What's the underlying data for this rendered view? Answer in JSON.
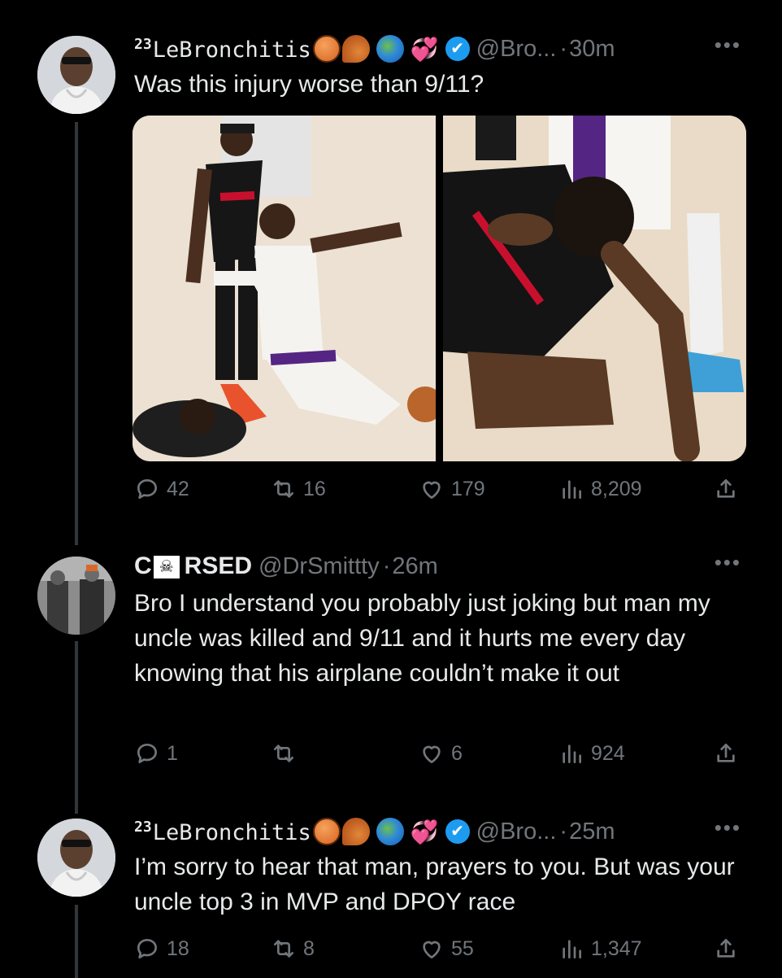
{
  "tweets": [
    {
      "name_sup": "23",
      "name": "LeBronchitis",
      "handle": "@Bro...",
      "dot": "·",
      "time": "30m",
      "more": "•••",
      "text": "Was this injury worse than 9/11?",
      "replies": "42",
      "retweets": "16",
      "likes": "179",
      "views": "8,209"
    },
    {
      "name": "C",
      "name_flag": "☠",
      "name_rest": "RSED",
      "handle": "@DrSmittty",
      "dot": "·",
      "time": "26m",
      "more": "•••",
      "text": "Bro I understand you probably just joking but man my uncle was killed and 9/11 and it hurts me every day knowing that his airplane couldn’t make it out",
      "replies": "1",
      "retweets": "",
      "likes": "6",
      "views": "924"
    },
    {
      "name_sup": "23",
      "name": "LeBronchitis",
      "handle": "@Bro...",
      "dot": "·",
      "time": "25m",
      "more": "•••",
      "text": "I’m sorry to hear that man, prayers to you. But was your uncle top 3 in MVP and DPOY race",
      "replies": "18",
      "retweets": "8",
      "likes": "55",
      "views": "1,347"
    }
  ],
  "icons": {
    "reply": "reply-icon",
    "retweet": "retweet-icon",
    "like": "heart-icon",
    "views": "views-icon",
    "share": "share-icon",
    "verified": "verified-badge-icon",
    "name_emojis": [
      "basketball-emoji",
      "comet-emoji",
      "globe-emoji",
      "hearts-emoji"
    ]
  },
  "verified_mark": "✔",
  "hearts_glyph": "💞",
  "colors": {
    "background": "#000000",
    "text": "#e7e9ea",
    "muted": "#71767b",
    "verified": "#1d9bf0",
    "thread_line": "#333639"
  }
}
